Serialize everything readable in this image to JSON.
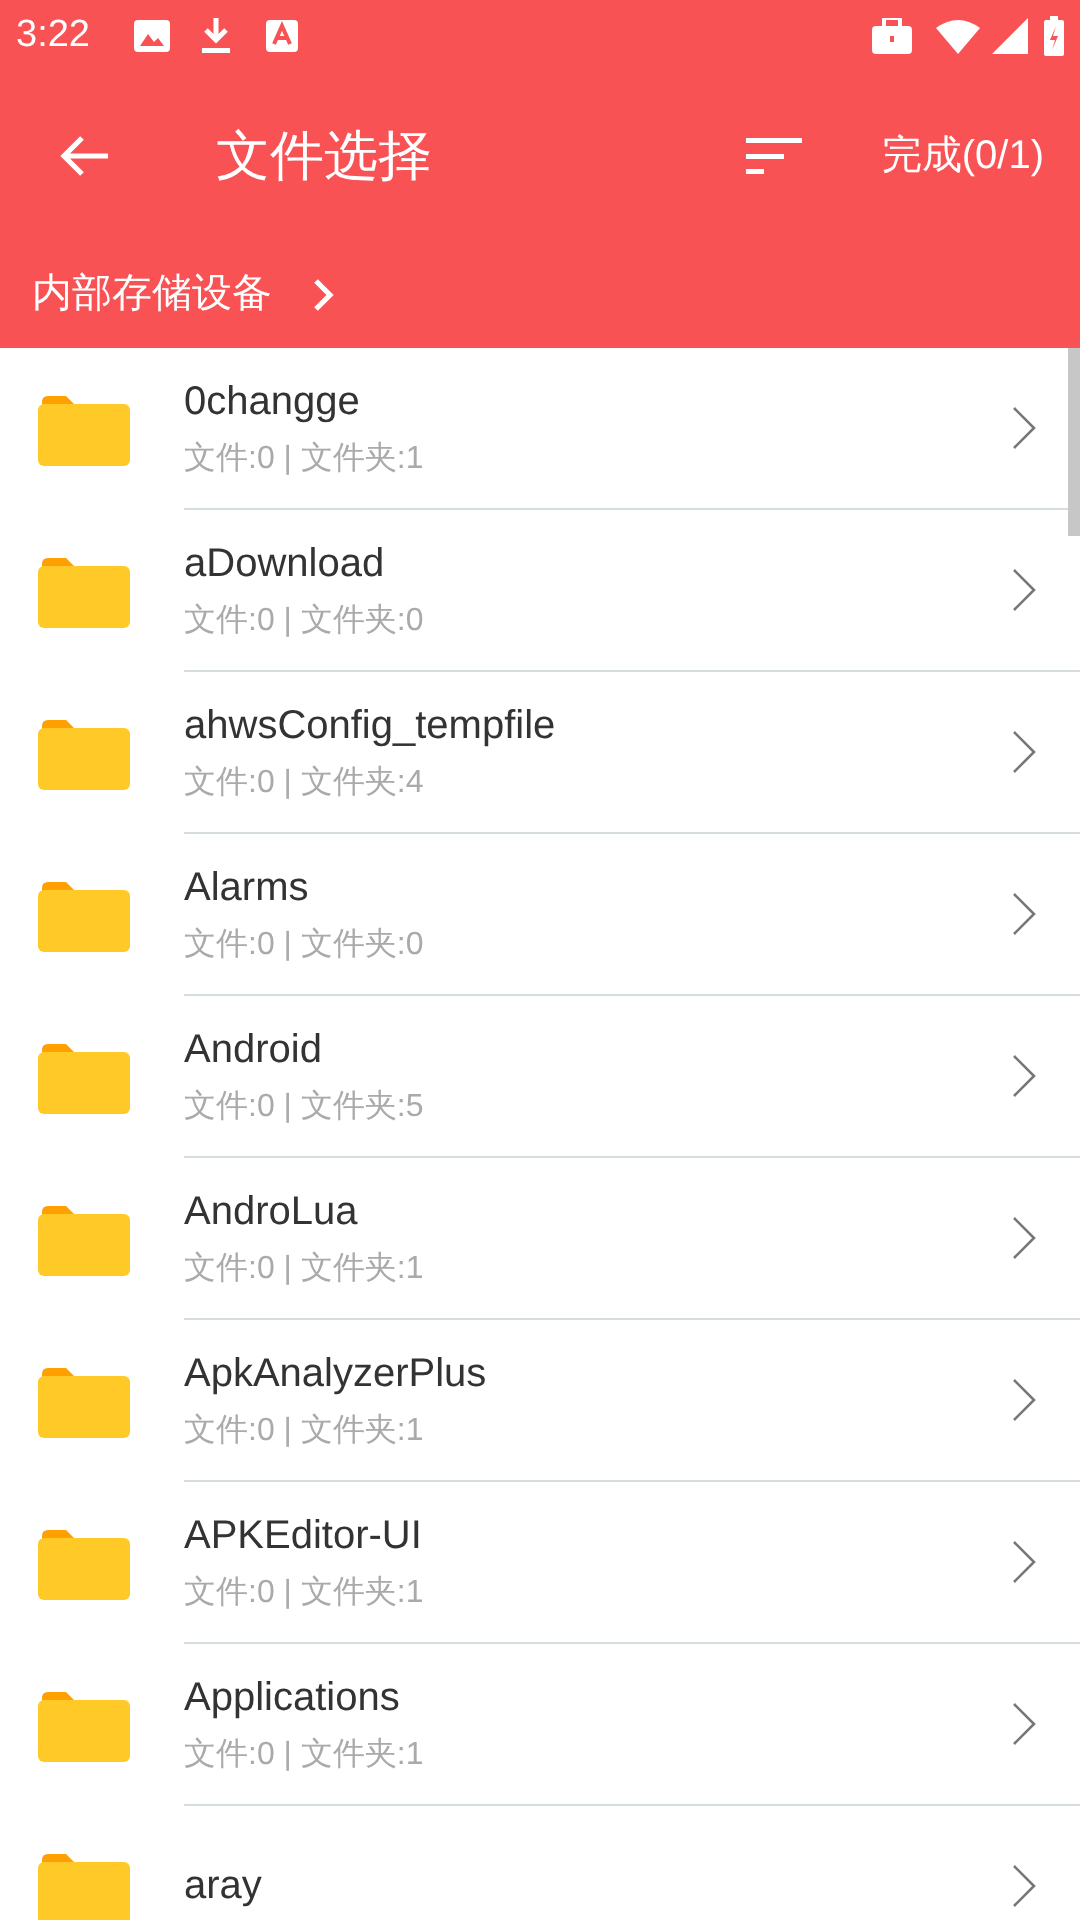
{
  "status_bar": {
    "time": "3:22"
  },
  "toolbar": {
    "title": "文件选择",
    "done_button": "完成(0/1)"
  },
  "breadcrumb": {
    "path": "内部存储设备"
  },
  "folders": [
    {
      "name": "0changge",
      "info": "文件:0 | 文件夹:1"
    },
    {
      "name": "aDownload",
      "info": "文件:0 | 文件夹:0"
    },
    {
      "name": "ahwsConfig_tempfile",
      "info": "文件:0 | 文件夹:4"
    },
    {
      "name": "Alarms",
      "info": "文件:0 | 文件夹:0"
    },
    {
      "name": "Android",
      "info": "文件:0 | 文件夹:5"
    },
    {
      "name": "AndroLua",
      "info": "文件:0 | 文件夹:1"
    },
    {
      "name": "ApkAnalyzerPlus",
      "info": "文件:0 | 文件夹:1"
    },
    {
      "name": "APKEditor-UI",
      "info": "文件:0 | 文件夹:1"
    },
    {
      "name": "Applications",
      "info": "文件:0 | 文件夹:1"
    },
    {
      "name": "aray"
    }
  ]
}
